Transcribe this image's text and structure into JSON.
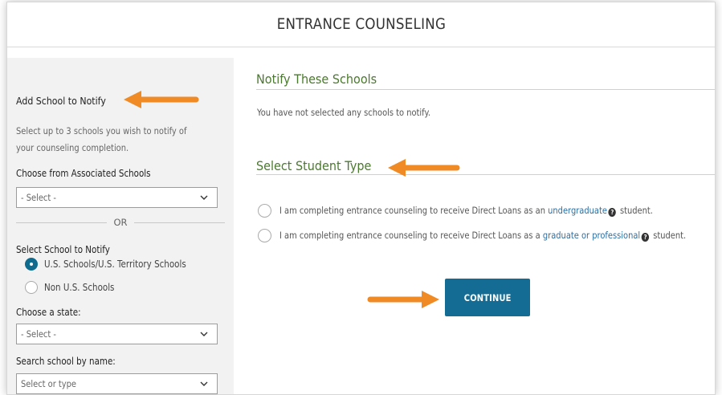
{
  "header": {
    "title": "ENTRANCE COUNSELING"
  },
  "sidebar": {
    "heading": "Add School to Notify",
    "description": "Select up to 3 schools you wish to notify of your counseling completion.",
    "associated_label": "Choose from Associated Schools",
    "associated_select": "- Select -",
    "or_text": "OR",
    "select_school_label": "Select School to Notify",
    "radio_us": "U.S. Schools/U.S. Territory Schools",
    "radio_non_us": "Non U.S. Schools",
    "state_label": "Choose a state:",
    "state_select": "- Select -",
    "search_label": "Search school by name:",
    "search_select": "Select or type"
  },
  "main": {
    "notify_heading": "Notify These Schools",
    "notify_empty": "You have not selected any schools to notify.",
    "student_type_heading": "Select Student Type",
    "option1_prefix": "I am completing entrance counseling to receive Direct Loans as an",
    "option1_link": "undergraduate",
    "option1_suffix": "student.",
    "option2_prefix": "I am completing entrance counseling to receive Direct Loans as a",
    "option2_link": "graduate or professional",
    "option2_suffix": "student.",
    "continue_label": "CONTINUE"
  },
  "colors": {
    "accent_green": "#4a7a2d",
    "button_blue": "#146c94",
    "arrow_orange": "#f08a24",
    "link_blue": "#2a6fa5"
  },
  "icons": [
    "chevron-down-icon",
    "help-circle-icon",
    "arrow-right-icon"
  ]
}
